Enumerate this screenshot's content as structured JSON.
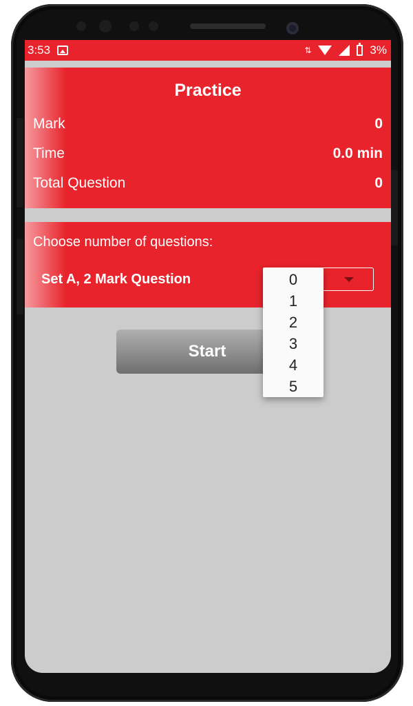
{
  "status_bar": {
    "time": "3:53",
    "battery": "3%",
    "icons": [
      "image-icon",
      "data-arrows-icon",
      "wifi-icon",
      "signal-icon",
      "battery-icon"
    ]
  },
  "stats_card": {
    "title": "Practice",
    "mark_label": "Mark",
    "mark_value": "0",
    "time_label": "Time",
    "time_value": "0.0 min",
    "total_label": "Total Question",
    "total_value": "0"
  },
  "choose_card": {
    "label": "Choose number of questions:",
    "set_label": "Set A, 2 Mark Question",
    "options": [
      "0",
      "1",
      "2",
      "3",
      "4",
      "5"
    ]
  },
  "start_button": {
    "label": "Start"
  },
  "colors": {
    "accent": "#e8232b",
    "background": "#cccccc",
    "button": "#8a8a8a"
  }
}
